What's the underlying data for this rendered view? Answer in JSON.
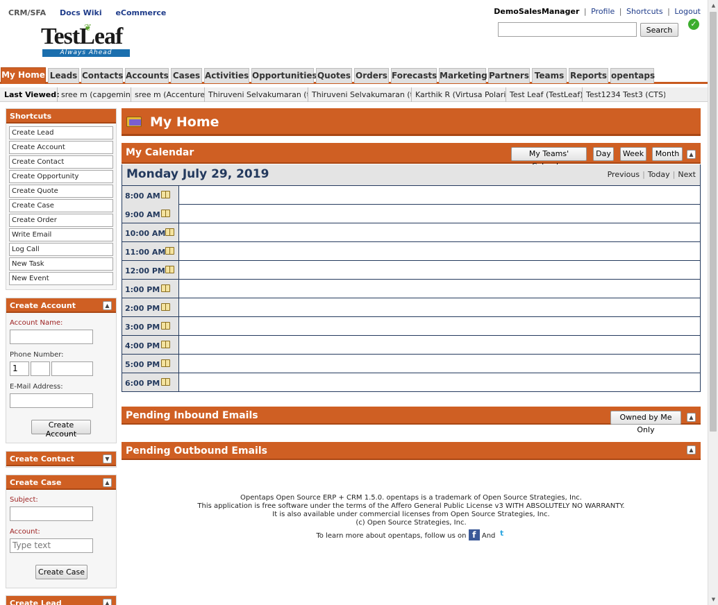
{
  "header": {
    "apps": [
      "CRM/SFA",
      "Docs Wiki",
      "eCommerce"
    ],
    "user": "DemoSalesManager",
    "profile_link": "Profile",
    "shortcuts_link": "Shortcuts",
    "logout_link": "Logout",
    "search_button": "Search",
    "logo_text": "TestLeaf",
    "logo_tagline": "Always Ahead"
  },
  "tabs": [
    "My Home",
    "Leads",
    "Contacts",
    "Accounts",
    "Cases",
    "Activities",
    "Opportunities",
    "Quotes",
    "Orders",
    "Forecasts",
    "Marketing",
    "Partners",
    "Teams",
    "Reports",
    "opentaps"
  ],
  "active_tab": "My Home",
  "last_viewed": {
    "label": "Last Viewed:",
    "items": [
      "sree m (capgemini)",
      "sree m (Accenture)",
      "Thiruveni Selvakumaran (t...",
      "Thiruveni Selvakumaran (t...",
      "Karthik R (Virtusa Polari...",
      "Test Leaf (TestLeaf)",
      "Test1234 Test3 (CTS)"
    ]
  },
  "sidebar": {
    "shortcuts_title": "Shortcuts",
    "shortcuts": [
      "Create Lead",
      "Create Account",
      "Create Contact",
      "Create Opportunity",
      "Create Quote",
      "Create Case",
      "Create Order",
      "Write Email",
      "Log Call",
      "New Task",
      "New Event"
    ],
    "create_account": {
      "title": "Create Account",
      "account_name_label": "Account Name:",
      "phone_label": "Phone Number:",
      "phone_country_code": "1",
      "email_label": "E-Mail Address:",
      "submit": "Create Account"
    },
    "create_contact": {
      "title": "Create Contact"
    },
    "create_case": {
      "title": "Create Case",
      "subject_label": "Subject:",
      "account_label": "Account:",
      "account_placeholder": "Type text",
      "submit": "Create Case"
    },
    "create_lead": {
      "title": "Create Lead"
    }
  },
  "main": {
    "title": "My Home",
    "calendar": {
      "title": "My Calendar",
      "buttons": [
        "My Teams' Calendar",
        "Day",
        "Week",
        "Month"
      ],
      "date": "Monday July 29, 2019",
      "nav": [
        "Previous",
        "Today",
        "Next"
      ],
      "times": [
        "8:00 AM",
        "9:00 AM",
        "10:00 AM",
        "11:00 AM",
        "12:00 PM",
        "1:00 PM",
        "2:00 PM",
        "3:00 PM",
        "4:00 PM",
        "5:00 PM",
        "6:00 PM"
      ]
    },
    "pending_inbound": {
      "title": "Pending Inbound Emails",
      "filter_button": "Owned by Me Only"
    },
    "pending_outbound": {
      "title": "Pending Outbound Emails"
    }
  },
  "footer": {
    "lines": [
      "Opentaps Open Source ERP + CRM 1.5.0. opentaps is a trademark of Open Source Strategies, Inc.",
      "This application is free software under the terms of the Affero General Public License v3 WITH ABSOLUTELY NO WARRANTY.",
      "It is also available under commercial licenses from Open Source Strategies, Inc.",
      "(c) Open Source Strategies, Inc."
    ],
    "follow_text": "To learn more about opentaps, follow us on",
    "and_text": "And"
  },
  "colors": {
    "brand_orange": "#cf5f23",
    "calendar_navy": "#23395d",
    "link_blue": "#1f3c8a"
  }
}
